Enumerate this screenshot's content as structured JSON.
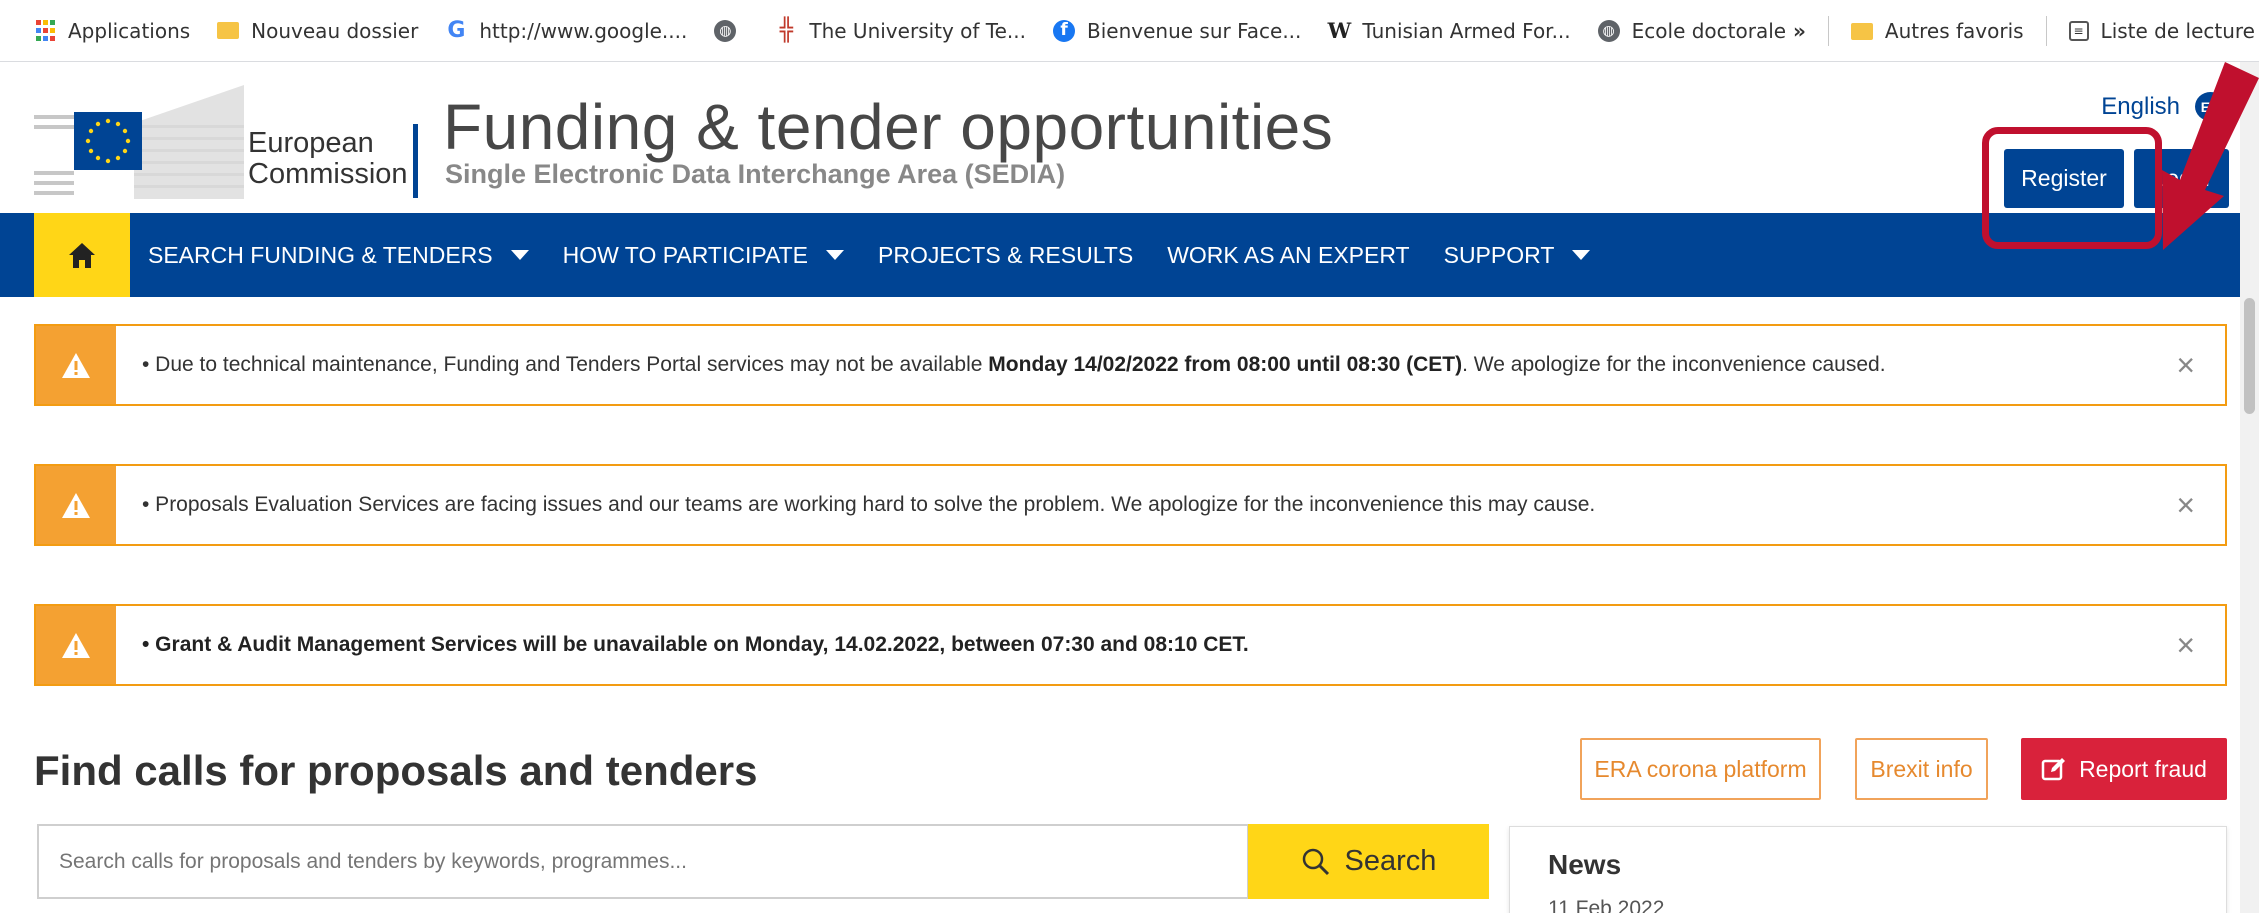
{
  "bookmarks": {
    "items": [
      {
        "icon": "apps-grid-icon",
        "label": "Applications"
      },
      {
        "icon": "folder-icon",
        "label": "Nouveau dossier"
      },
      {
        "icon": "google-icon",
        "label": "http://www.google...."
      },
      {
        "icon": "globe-icon",
        "label": ""
      },
      {
        "icon": "university-icon",
        "label": "The University of Te..."
      },
      {
        "icon": "facebook-icon",
        "label": "Bienvenue sur Face..."
      },
      {
        "icon": "wikipedia-icon",
        "label": "Tunisian Armed For..."
      },
      {
        "icon": "globe-icon",
        "label": "Ecole doctorale"
      }
    ],
    "overflow": "»",
    "other_favorites": "Autres favoris",
    "reading_list": "Liste de lecture"
  },
  "header": {
    "logo_text_line1": "European",
    "logo_text_line2": "Commission",
    "title": "Funding & tender opportunities",
    "subtitle": "Single Electronic Data Interchange Area (SEDIA)",
    "language": "English",
    "language_code": "EN",
    "register_label": "Register",
    "login_label": "Login"
  },
  "nav": {
    "items": [
      {
        "label": "SEARCH FUNDING & TENDERS",
        "dropdown": true
      },
      {
        "label": "HOW TO PARTICIPATE",
        "dropdown": true
      },
      {
        "label": "PROJECTS & RESULTS",
        "dropdown": false
      },
      {
        "label": "WORK AS AN EXPERT",
        "dropdown": false
      },
      {
        "label": "SUPPORT",
        "dropdown": true
      }
    ]
  },
  "alerts": [
    {
      "prefix": "• Due to technical maintenance, Funding and Tenders Portal services may not be available ",
      "bold": "Monday 14/02/2022 from 08:00 until 08:30 (CET)",
      "suffix": ". We apologize for the inconvenience caused."
    },
    {
      "prefix": "• Proposals Evaluation Services are facing issues and our teams are working hard to solve the problem. We apologize for the inconvenience this may cause.",
      "bold": "",
      "suffix": ""
    },
    {
      "prefix": "",
      "bold": "• Grant & Audit Management Services will be unavailable on Monday, 14.02.2022, between 07:30 and 08:10 CET.",
      "suffix": ""
    }
  ],
  "alert_close_glyph": "×",
  "find": {
    "title": "Find calls for proposals and tenders",
    "era_label": "ERA corona platform",
    "brexit_label": "Brexit info",
    "fraud_label": "Report fraud",
    "search_placeholder": "Search calls for proposals and tenders by keywords, programmes...",
    "search_button": "Search"
  },
  "news": {
    "title": "News",
    "date": "11 Feb 2022"
  },
  "colors": {
    "ec_blue": "#004494",
    "ec_yellow": "#ffd617",
    "alert_orange": "#f4a132",
    "fraud_red": "#d9223b",
    "annotation_red": "#c0102e"
  }
}
